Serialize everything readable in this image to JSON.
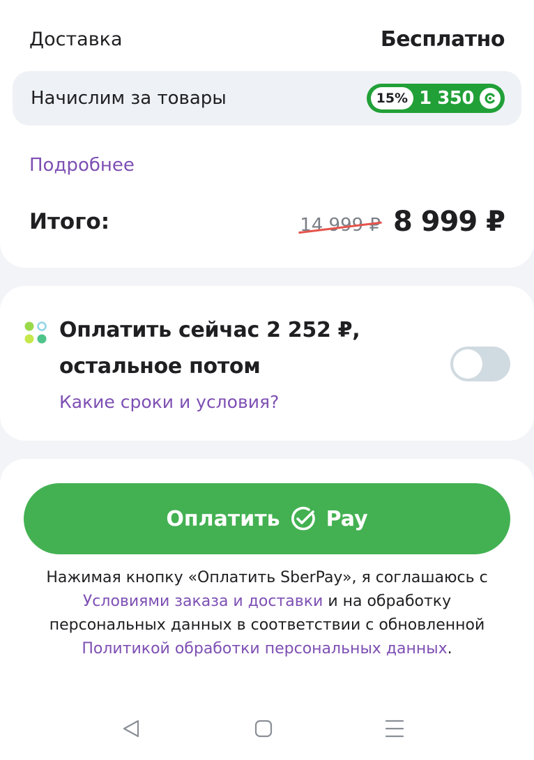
{
  "summary": {
    "delivery_label": "Доставка",
    "delivery_value": "Бесплатно",
    "bonus_label": "Начислим за товары",
    "bonus_percent": "15%",
    "bonus_amount": "1 350",
    "more_link": "Подробнее",
    "total_label": "Итого:",
    "old_price": "14 999 ₽",
    "new_price": "8 999 ₽"
  },
  "bnpl": {
    "title_line1": "Оплатить сейчас 2 252 ₽,",
    "title_line2": "остальное потом",
    "terms_link": "Какие сроки и условия?",
    "toggle_on": false
  },
  "pay": {
    "button_label": "Оплатить",
    "button_brand": "Pay",
    "legal_prefix": "Нажимая кнопку «Оплатить SberPay», я соглашаюсь с ",
    "legal_link1": "Условиями заказа и доставки",
    "legal_middle": " и на обработку персональных данных в соответствии с обновленной ",
    "legal_link2": "Политикой обработки персональных данных",
    "legal_suffix": "."
  },
  "colors": {
    "accent_green": "#43b152",
    "badge_green": "#21a038",
    "link_purple": "#7d4fb3"
  },
  "icons": {
    "app_logo": "four-dots-icon",
    "coin": "bonus-coin-icon",
    "pay": "check-circle-icon",
    "nav_back": "triangle-back-icon",
    "nav_home": "square-home-icon",
    "nav_menu": "three-lines-menu-icon"
  }
}
